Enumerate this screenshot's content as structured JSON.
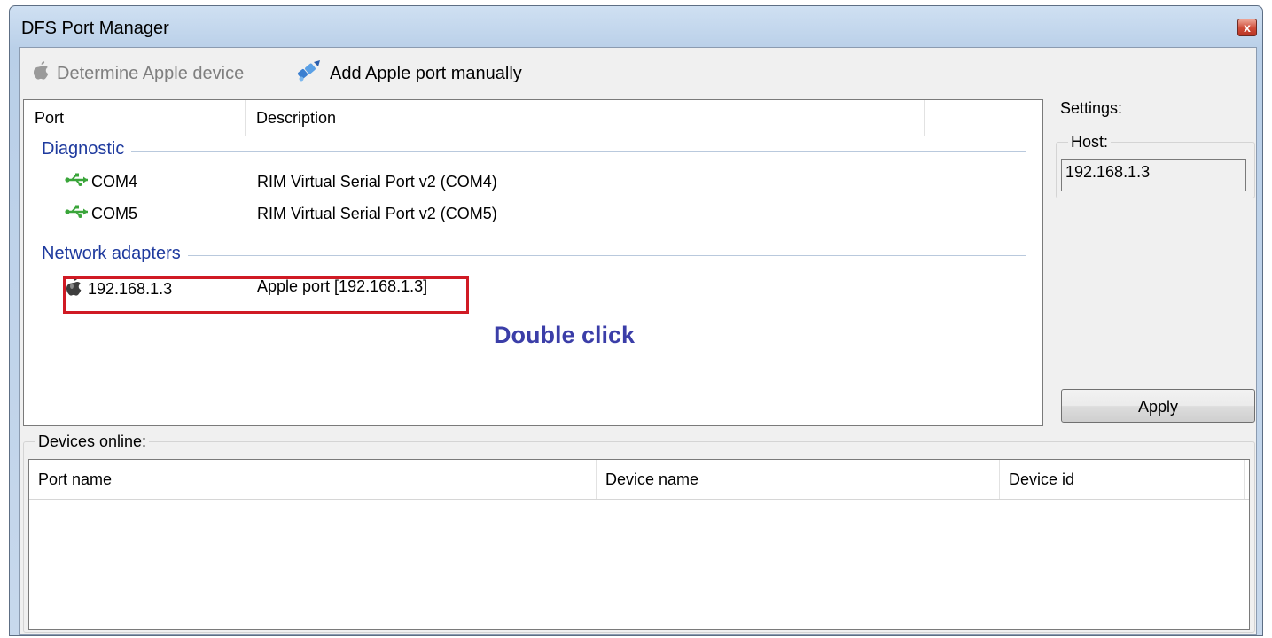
{
  "window": {
    "title": "DFS Port Manager",
    "close_glyph": "x"
  },
  "toolbar": {
    "determine_label": "Determine Apple device",
    "add_label": "Add Apple port manually"
  },
  "port_list": {
    "columns": [
      "Port",
      "Description",
      ""
    ],
    "groups": [
      {
        "label": "Diagnostic",
        "rows": [
          {
            "port": "COM4",
            "description": "RIM Virtual Serial Port v2 (COM4)",
            "icon": "usb-icon"
          },
          {
            "port": "COM5",
            "description": "RIM Virtual Serial Port v2 (COM5)",
            "icon": "usb-icon"
          }
        ]
      },
      {
        "label": "Network adapters",
        "rows": [
          {
            "port": "192.168.1.3",
            "description": "Apple port [192.168.1.3]",
            "icon": "apple-icon"
          }
        ]
      }
    ]
  },
  "annotation": {
    "text": "Double click",
    "color": "#3b3ea8",
    "highlight_color": "#d01a24"
  },
  "settings": {
    "label": "Settings:",
    "host_label": "Host:",
    "host_value": "192.168.1.3",
    "apply_label": "Apply"
  },
  "devices": {
    "label": "Devices online:",
    "columns": [
      "Port name",
      "Device name",
      "Device id"
    ]
  },
  "colors": {
    "group_label": "#1e3a9e",
    "usb_icon": "#3aa53a"
  }
}
